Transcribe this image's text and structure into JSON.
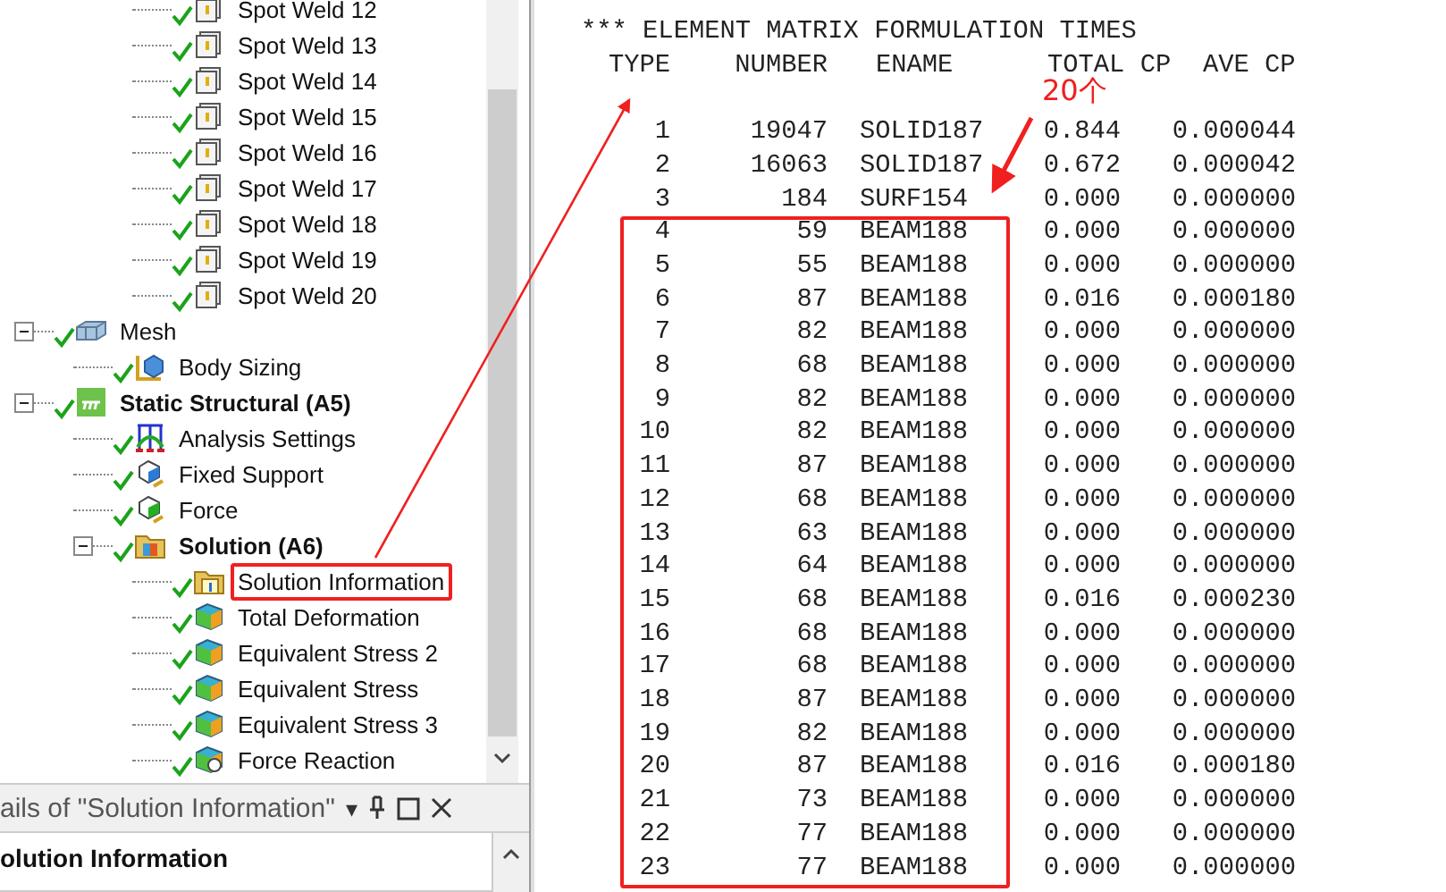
{
  "tree": {
    "spot_welds": [
      {
        "label": "Spot Weld 12",
        "kind": "weld",
        "checked": true
      },
      {
        "label": "Spot Weld 13",
        "kind": "weld",
        "checked": true
      },
      {
        "label": "Spot Weld 14",
        "kind": "weld",
        "checked": true
      },
      {
        "label": "Spot Weld 15",
        "kind": "weld",
        "checked": true
      },
      {
        "label": "Spot Weld 16",
        "kind": "weld",
        "checked": true
      },
      {
        "label": "Spot Weld 17",
        "kind": "weld",
        "checked": true
      },
      {
        "label": "Spot Weld 18",
        "kind": "weld",
        "checked": true
      },
      {
        "label": "Spot Weld 19",
        "kind": "weld",
        "checked": true
      },
      {
        "label": "Spot Weld 20",
        "kind": "weld",
        "checked": true
      }
    ],
    "nodes": [
      {
        "label": "Mesh",
        "kind": "mesh",
        "checked": true,
        "bold": false,
        "expanded": true,
        "children": [
          {
            "label": "Body Sizing",
            "kind": "sizing",
            "checked": true,
            "bold": false
          }
        ]
      },
      {
        "label": "Static Structural (A5)",
        "kind": "static",
        "checked": true,
        "bold": true,
        "expanded": true,
        "children": [
          {
            "label": "Analysis Settings",
            "kind": "settings",
            "checked": true,
            "bold": false
          },
          {
            "label": "Fixed Support",
            "kind": "support",
            "checked": true,
            "bold": false
          },
          {
            "label": "Force",
            "kind": "force",
            "checked": true,
            "bold": false
          },
          {
            "label": "Solution (A6)",
            "kind": "solution",
            "checked": true,
            "bold": true,
            "expanded": true,
            "children": [
              {
                "label": "Solution Information",
                "kind": "info",
                "checked": true,
                "bold": false,
                "highlighted": true
              },
              {
                "label": "Total Deformation",
                "kind": "result",
                "checked": true,
                "bold": false,
                "highlighted": false
              },
              {
                "label": "Equivalent Stress 2",
                "kind": "result",
                "checked": true,
                "bold": false,
                "highlighted": false
              },
              {
                "label": "Equivalent Stress",
                "kind": "result",
                "checked": true,
                "bold": false,
                "highlighted": false
              },
              {
                "label": "Equivalent Stress 3",
                "kind": "result",
                "checked": true,
                "bold": false,
                "highlighted": false
              },
              {
                "label": "Force Reaction",
                "kind": "reaction",
                "checked": true,
                "bold": false,
                "highlighted": false
              }
            ]
          }
        ]
      }
    ]
  },
  "details": {
    "title": "ails of \"Solution Information\"",
    "dropdown": "▾",
    "section": "olution Information"
  },
  "output": {
    "title": "*** ELEMENT MATRIX FORMULATION TIMES",
    "columns": [
      "TYPE",
      "NUMBER",
      "ENAME",
      "TOTAL CP",
      "AVE CP"
    ],
    "annotation": "20个",
    "rows": [
      {
        "cells": [
          "1",
          "19047",
          "SOLID187",
          "0.844",
          "0.000044"
        ]
      },
      {
        "cells": [
          "2",
          "16063",
          "SOLID187",
          "0.672",
          "0.000042"
        ]
      },
      {
        "cells": [
          "3",
          "184",
          "SURF154",
          "0.000",
          "0.000000"
        ]
      }
    ],
    "highlight_box": {
      "rows": [
        {
          "cells": [
            "4",
            "59",
            "BEAM188",
            "0.000",
            "0.000000"
          ]
        },
        {
          "cells": [
            "5",
            "55",
            "BEAM188",
            "0.000",
            "0.000000"
          ]
        },
        {
          "cells": [
            "6",
            "87",
            "BEAM188",
            "0.016",
            "0.000180"
          ]
        },
        {
          "cells": [
            "7",
            "82",
            "BEAM188",
            "0.000",
            "0.000000"
          ]
        },
        {
          "cells": [
            "8",
            "68",
            "BEAM188",
            "0.000",
            "0.000000"
          ]
        },
        {
          "cells": [
            "9",
            "82",
            "BEAM188",
            "0.000",
            "0.000000"
          ]
        },
        {
          "cells": [
            "10",
            "82",
            "BEAM188",
            "0.000",
            "0.000000"
          ]
        },
        {
          "cells": [
            "11",
            "87",
            "BEAM188",
            "0.000",
            "0.000000"
          ]
        },
        {
          "cells": [
            "12",
            "68",
            "BEAM188",
            "0.000",
            "0.000000"
          ]
        },
        {
          "cells": [
            "13",
            "63",
            "BEAM188",
            "0.000",
            "0.000000"
          ]
        },
        {
          "cells": [
            "14",
            "64",
            "BEAM188",
            "0.000",
            "0.000000"
          ]
        },
        {
          "cells": [
            "15",
            "68",
            "BEAM188",
            "0.016",
            "0.000230"
          ]
        },
        {
          "cells": [
            "16",
            "68",
            "BEAM188",
            "0.000",
            "0.000000"
          ]
        },
        {
          "cells": [
            "17",
            "68",
            "BEAM188",
            "0.000",
            "0.000000"
          ]
        },
        {
          "cells": [
            "18",
            "87",
            "BEAM188",
            "0.000",
            "0.000000"
          ]
        },
        {
          "cells": [
            "19",
            "82",
            "BEAM188",
            "0.000",
            "0.000000"
          ]
        },
        {
          "cells": [
            "20",
            "87",
            "BEAM188",
            "0.016",
            "0.000180"
          ]
        },
        {
          "cells": [
            "21",
            "73",
            "BEAM188",
            "0.000",
            "0.000000"
          ]
        },
        {
          "cells": [
            "22",
            "77",
            "BEAM188",
            "0.000",
            "0.000000"
          ]
        },
        {
          "cells": [
            "23",
            "77",
            "BEAM188",
            "0.000",
            "0.000000"
          ]
        }
      ]
    }
  }
}
